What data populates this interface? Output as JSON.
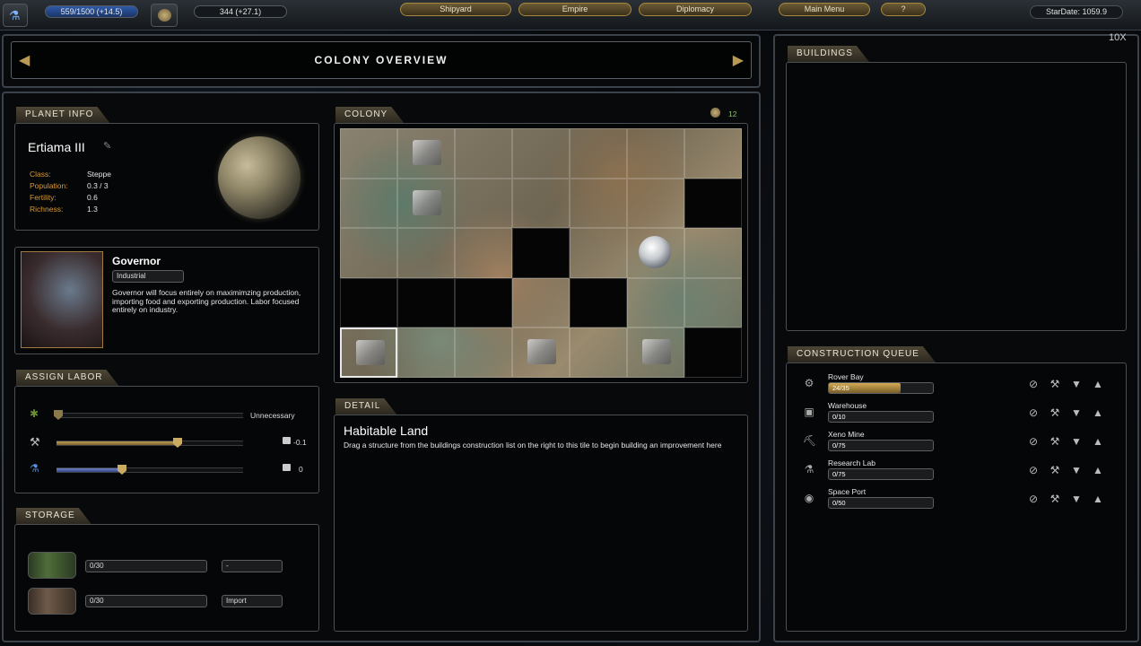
{
  "topbar": {
    "research": "559/1500 (+14.5)",
    "credits": "344 (+27.1)",
    "buttons": [
      "Shipyard",
      "Empire",
      "Diplomacy",
      "Main Menu",
      "?"
    ],
    "stardate": "StarDate: 1059.9"
  },
  "header": {
    "title": "COLONY OVERVIEW",
    "close_label": "10X"
  },
  "planet_info": {
    "tab": "PLANET INFO",
    "name": "Ertiama III",
    "class_label": "Class:",
    "class_value": "Steppe",
    "population_label": "Population:",
    "population_value": "0.3 / 3",
    "fertility_label": "Fertility:",
    "fertility_value": "0.6",
    "richness_label": "Richness:",
    "richness_value": "1.3"
  },
  "governor": {
    "title": "Governor",
    "mode": "Industrial",
    "description": "Governor will focus entirely on maximimzing production, importing food and exporting production. Labor focused entirely on industry."
  },
  "assign_labor": {
    "tab": "ASSIGN LABOR",
    "rows": [
      {
        "icon": "wheat-icon",
        "fill": 0.0,
        "value": "Unnecessary",
        "locked": false
      },
      {
        "icon": "hammer-icon",
        "fill": 0.65,
        "value": "-0.1",
        "locked": true
      },
      {
        "icon": "flask-icon",
        "fill": 0.35,
        "value": "0",
        "locked": true
      }
    ]
  },
  "storage": {
    "tab": "STORAGE",
    "rows": [
      {
        "icon": "food-barrel-icon",
        "amount": "0/30",
        "action": "-"
      },
      {
        "icon": "production-barrel-icon",
        "amount": "0/30",
        "action": "Import"
      }
    ]
  },
  "colony": {
    "tab": "COLONY",
    "count": "12",
    "grid_cols": 7,
    "grid_rows": 5,
    "dark_tiles": [
      [
        1,
        6
      ],
      [
        2,
        3
      ],
      [
        3,
        0
      ],
      [
        3,
        1
      ],
      [
        3,
        2
      ],
      [
        3,
        4
      ],
      [
        4,
        6
      ]
    ],
    "buildings": [
      [
        0,
        1,
        "warehouse"
      ],
      [
        1,
        1,
        "warehouse"
      ],
      [
        2,
        5,
        "dome"
      ],
      [
        4,
        0,
        "research"
      ],
      [
        4,
        3,
        "mine"
      ],
      [
        4,
        5,
        "warehouse"
      ]
    ],
    "selected": [
      4,
      0
    ]
  },
  "detail": {
    "tab": "DETAIL",
    "title": "Habitable Land",
    "text": "Drag a structure from the buildings construction list on the right to this tile to begin building an improvement here"
  },
  "buildings": {
    "tab": "BUILDINGS"
  },
  "construction_queue": {
    "tab": "CONSTRUCTION QUEUE",
    "items": [
      {
        "name": "Rover Bay",
        "progress": "24/35",
        "fill": 0.686
      },
      {
        "name": "Warehouse",
        "progress": "0/10",
        "fill": 0
      },
      {
        "name": "Xeno Mine",
        "progress": "0/75",
        "fill": 0
      },
      {
        "name": "Research Lab",
        "progress": "0/75",
        "fill": 0
      },
      {
        "name": "Space Port",
        "progress": "0/50",
        "fill": 0
      }
    ]
  }
}
